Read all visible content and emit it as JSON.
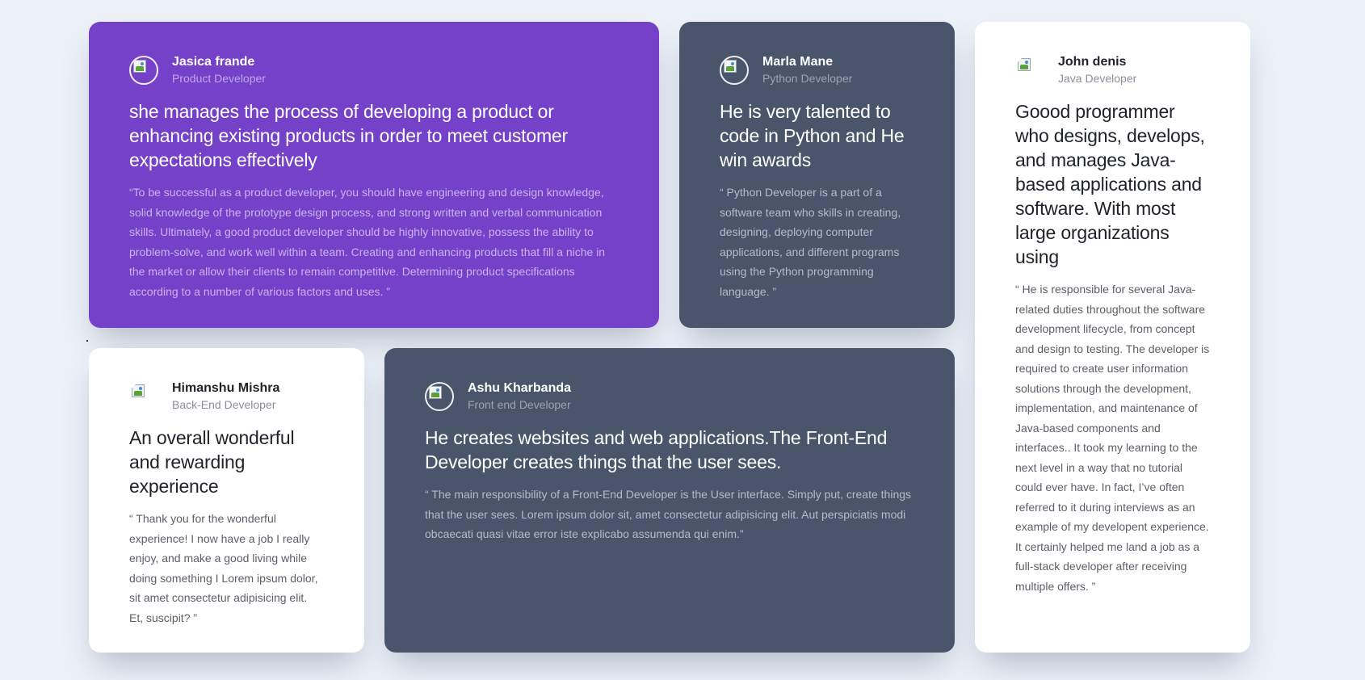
{
  "testimonials": [
    {
      "name": "Jasica frande",
      "role": "Product Developer",
      "headline": "she manages the process of developing a product or enhancing existing products in order to meet customer expectations effectively",
      "quote": "“To be successful as a product developer, you should have engineering and design knowledge, solid knowledge of the prototype design process, and strong written and verbal communication skills. Ultimately, a good product developer should be highly innovative, possess the ability to problem-solve, and work well within a team. Creating and enhancing products that fill a niche in the market or allow their clients to remain competitive. Determining product specifications according to a number of various factors and uses. ”",
      "background": "#7541c8"
    },
    {
      "name": "Marla Mane",
      "role": "Python Developer",
      "headline": "He is very talented to code in Python and He win awards",
      "quote": "“ Python Developer is a part of a software team who skills in creating, designing, deploying computer applications, and different programs using the Python programming language. ”",
      "background": "#48556a"
    },
    {
      "name": "John denis",
      "role": "Java Developer",
      "headline": "Goood programmer who designs, develops, and manages Java-based applications and software. With most large organizations using",
      "quote": "“ He is responsible for several Java-related duties throughout the software development lifecycle, from concept and design to testing. The developer is required to create user information solutions through the development, implementation, and maintenance of Java-based components and interfaces.. It took my learning to the next level in a way that no tutorial could ever have. In fact, I’ve often referred to it during interviews as an example of my developent experience. It certainly helped me land a job as a full-stack developer after receiving multiple offers. ”",
      "background": "#ffffff"
    },
    {
      "name": "Himanshu Mishra",
      "role": "Back-End Developer",
      "headline": "An overall wonderful and rewarding experience",
      "quote": "“ Thank you for the wonderful experience! I now have a job I really enjoy, and make a good living while doing something I Lorem ipsum dolor, sit amet consectetur adipisicing elit. Et, suscipit? ”",
      "background": "#ffffff"
    },
    {
      "name": "Ashu Kharbanda",
      "role": "Front end Developer",
      "headline": "He creates websites and web applications.The Front-End Developer creates things that the user sees.",
      "quote": "“ The main responsibility of a Front-End Developer is the User interface. Simply put, create things that the user sees. Lorem ipsum dolor sit, amet consectetur adipisicing elit. Aut perspiciatis modi obcaecati quasi vitae error iste explicabo assumenda qui enim.”",
      "background": "#48556a"
    }
  ]
}
